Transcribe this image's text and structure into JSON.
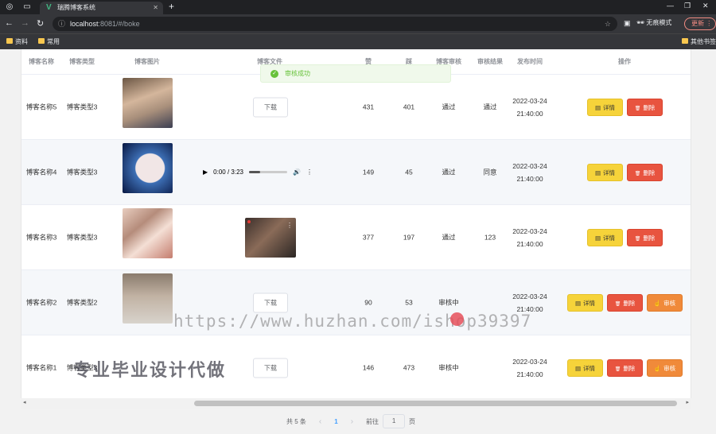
{
  "browser": {
    "tab_title": "瑞腾博客系统",
    "url_host": "localhost",
    "url_rest": ":8081/#/boke",
    "incognito_label": "无痕模式",
    "update_label": "更新",
    "bookmarks": [
      "资料",
      "常用"
    ],
    "other_bookmarks": "其他书签"
  },
  "table": {
    "headers": {
      "name": "博客名称",
      "type": "博客类型",
      "image": "博客图片",
      "file": "博客文件",
      "col5": "赞",
      "col6": "踩",
      "review": "博客审核",
      "result": "审核结果",
      "time": "发布时间",
      "ops": "操作"
    },
    "rows": [
      {
        "name": "博客名称5",
        "type": "博客类型3",
        "media": "download",
        "c5": "431",
        "c6": "401",
        "review": "通过",
        "result": "通过",
        "time": "2022-03-24 21:40:00",
        "audit": false
      },
      {
        "name": "博客名称4",
        "type": "博客类型3",
        "media": "audio",
        "c5": "149",
        "c6": "45",
        "review": "通过",
        "result": "同意",
        "time": "2022-03-24 21:40:00",
        "audit": false
      },
      {
        "name": "博客名称3",
        "type": "博客类型3",
        "media": "video",
        "c5": "377",
        "c6": "197",
        "review": "通过",
        "result": "123",
        "time": "2022-03-24 21:40:00",
        "audit": false
      },
      {
        "name": "博客名称2",
        "type": "博客类型2",
        "media": "download",
        "c5": "90",
        "c6": "53",
        "review": "审核中",
        "result": "",
        "time": "2022-03-24 21:40:00",
        "audit": true
      },
      {
        "name": "博客名称1",
        "type": "博客类型3",
        "media": "download",
        "c5": "146",
        "c6": "473",
        "review": "审核中",
        "result": "",
        "time": "2022-03-24 21:40:00",
        "audit": true
      }
    ],
    "download_label": "下载",
    "audio_time": "0:00 / 3:23",
    "detail_label": "详情",
    "delete_label": "删除",
    "audit_label": "审核"
  },
  "toast": {
    "message": "审核成功"
  },
  "pagination": {
    "total": "共 5 条",
    "current": "1",
    "goto": "前往",
    "page_value": "1",
    "page_unit": "页"
  },
  "watermark": {
    "url": "https://www.huzhan.com/ishop39397",
    "slogan": "专业毕业设计代做"
  }
}
